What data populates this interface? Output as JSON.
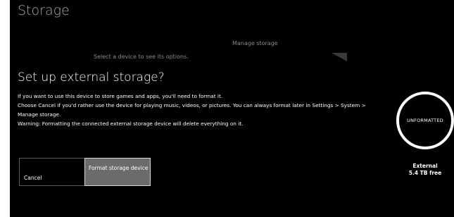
{
  "background": {
    "page_title": "Storage",
    "section_label": "Manage storage",
    "hint": "Select a device to see its options."
  },
  "dialog": {
    "title": "Set up external storage?",
    "lines": [
      "If you want to use this device to store games and apps, you'll need to format it.",
      "Choose Cancel if you'd rather use the device for playing music, videos, or pictures. You can always format later in Settings > System > Manage storage.",
      "Warning: Formatting the connected external storage device will delete everything on it."
    ],
    "buttons": {
      "cancel": "Cancel",
      "format": "Format storage device"
    }
  },
  "device": {
    "status": "UNFORMATTED",
    "name": "External",
    "free": "5.4 TB free"
  }
}
